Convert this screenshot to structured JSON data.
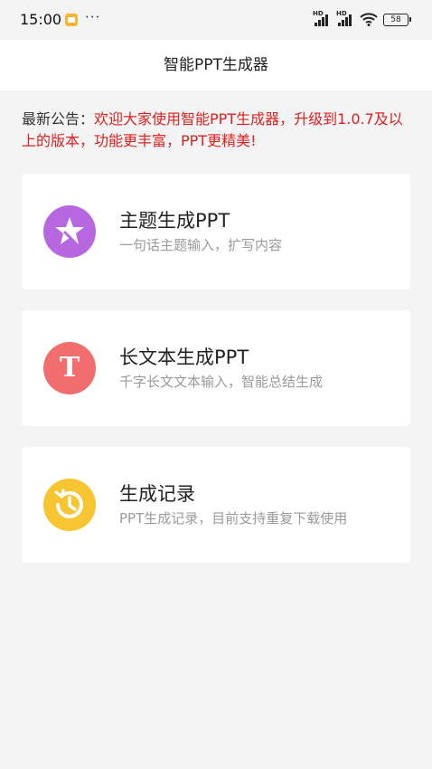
{
  "status_bar": {
    "time": "15:00",
    "more": "···",
    "signal1_label": "HD",
    "signal2_label": "HD",
    "battery": "58",
    "icons": [
      "notification-app-icon",
      "signal-icon",
      "signal-icon",
      "wifi-icon",
      "battery-icon"
    ]
  },
  "app_bar": {
    "title": "智能PPT生成器"
  },
  "notice": {
    "label": "最新公告：",
    "text": "欢迎大家使用智能PPT生成器，升级到1.0.7及以上的版本，功能更丰富，PPT更精美!"
  },
  "cards": [
    {
      "title": "主题生成PPT",
      "subtitle": "一句话主题输入，扩写内容",
      "icon": "star-wand-icon",
      "icon_color": "#b768e0"
    },
    {
      "title": "长文本生成PPT",
      "subtitle": "千字长文文本输入，智能总结生成",
      "icon": "text-t-icon",
      "icon_glyph": "T",
      "icon_color": "#f26d6d"
    },
    {
      "title": "生成记录",
      "subtitle": "PPT生成记录，目前支持重复下载使用",
      "icon": "clock-history-icon",
      "icon_color": "#f7c531"
    }
  ]
}
